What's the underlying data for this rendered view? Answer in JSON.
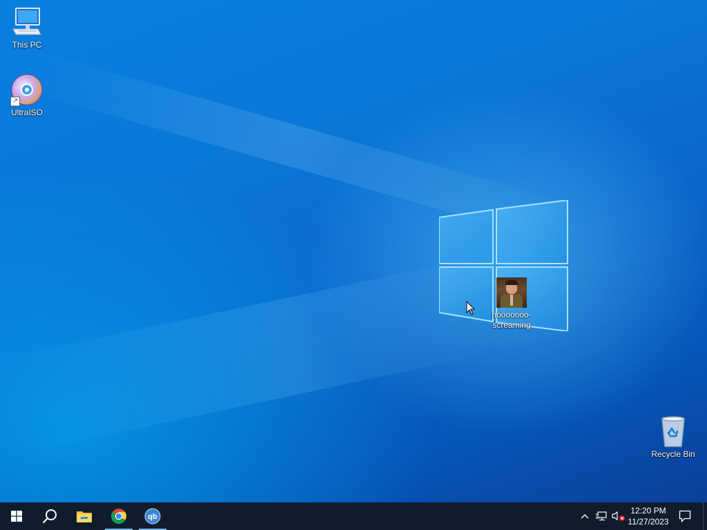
{
  "desktop": {
    "icons": {
      "this_pc": {
        "label": "This PC",
        "icon": "monitor-icon"
      },
      "ultraiso": {
        "label": "UltraISO",
        "icon": "disc-icon"
      },
      "meme": {
        "label": "nooooooo-screaming",
        "icon": "image-thumbnail"
      },
      "recycle_bin": {
        "label": "Recycle Bin",
        "icon": "recycle-bin-icon"
      }
    }
  },
  "taskbar": {
    "apps": [
      {
        "name": "Start",
        "icon": "windows-start-icon"
      },
      {
        "name": "Search",
        "icon": "search-icon"
      },
      {
        "name": "File Explorer",
        "icon": "folder-icon",
        "active": false
      },
      {
        "name": "Google Chrome",
        "icon": "chrome-icon",
        "active": true
      },
      {
        "name": "qBittorrent",
        "icon": "qbittorrent-icon",
        "active": true,
        "glyph": "qb"
      }
    ],
    "tray": {
      "time": "12:20 PM",
      "date": "11/27/2023"
    }
  },
  "colors": {
    "taskbar_bg": "#101c2c",
    "accent_underline": "#76b9ed",
    "desktop_blue": "#0a78d8"
  }
}
